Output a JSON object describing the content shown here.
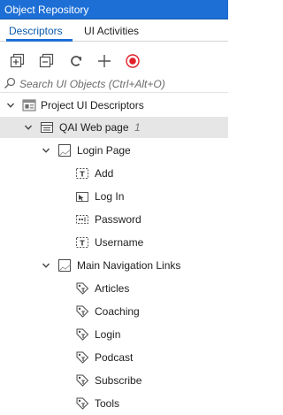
{
  "panel": {
    "title": "Object Repository"
  },
  "tabs": [
    {
      "label": "Descriptors",
      "active": true
    },
    {
      "label": "UI Activities",
      "active": false
    }
  ],
  "toolbar": {
    "buttons": [
      {
        "name": "expand-all",
        "icon": "expand-all-icon"
      },
      {
        "name": "collapse-all",
        "icon": "collapse-all-icon"
      },
      {
        "name": "refresh",
        "icon": "refresh-icon"
      },
      {
        "name": "add",
        "icon": "plus-icon"
      },
      {
        "name": "record",
        "icon": "record-icon"
      }
    ],
    "record_color": "#e0202a"
  },
  "search": {
    "placeholder": "Search UI Objects (Ctrl+Alt+O)"
  },
  "tree": {
    "root": {
      "label": "Project UI Descriptors"
    },
    "app": {
      "label": "QAI Web page",
      "count": "1"
    },
    "screens": [
      {
        "label": "Login Page",
        "elements": [
          {
            "label": "Add",
            "icon": "text-element-icon"
          },
          {
            "label": "Log In",
            "icon": "click-element-icon"
          },
          {
            "label": "Password",
            "icon": "input-element-icon"
          },
          {
            "label": "Username",
            "icon": "text-element-icon"
          }
        ]
      },
      {
        "label": "Main Navigation Links",
        "elements": [
          {
            "label": "Articles",
            "icon": "link-tag-icon"
          },
          {
            "label": "Coaching",
            "icon": "link-tag-icon"
          },
          {
            "label": "Login",
            "icon": "link-tag-icon"
          },
          {
            "label": "Podcast",
            "icon": "link-tag-icon"
          },
          {
            "label": "Subscribe",
            "icon": "link-tag-icon"
          },
          {
            "label": "Tools",
            "icon": "link-tag-icon"
          }
        ]
      }
    ]
  },
  "colors": {
    "accent": "#1d6fd6",
    "selected_row": "#e6e6e6"
  }
}
